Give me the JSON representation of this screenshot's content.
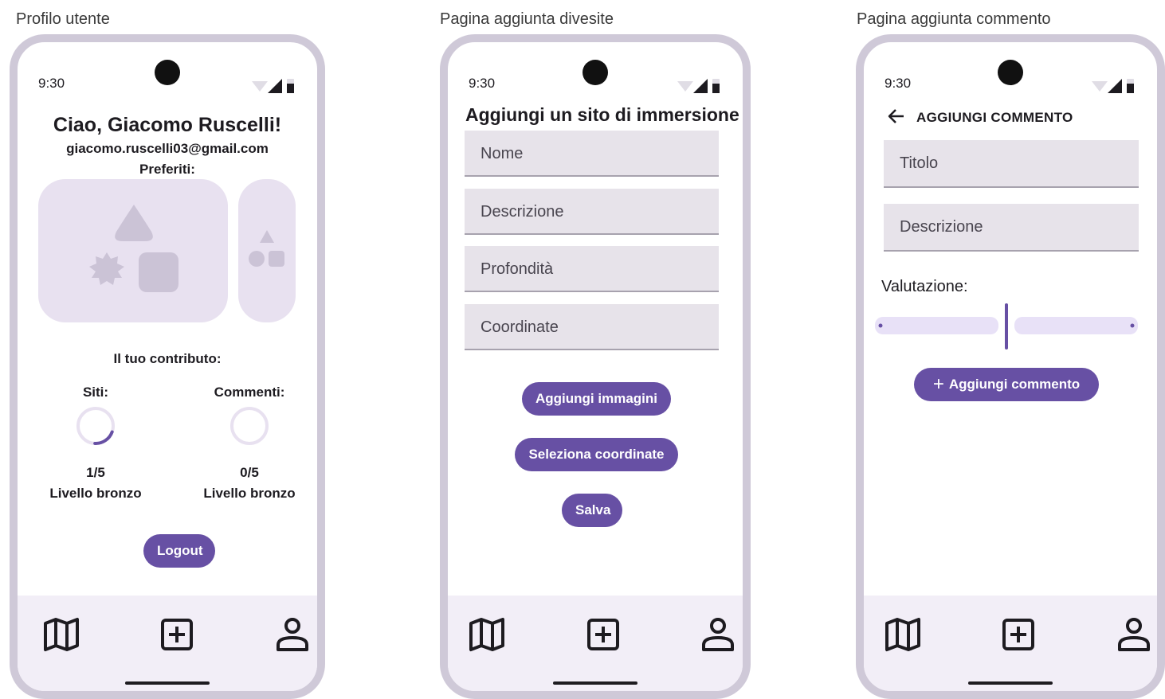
{
  "screens": [
    {
      "title": "Profilo utente"
    },
    {
      "title": "Pagina aggiunta divesite"
    },
    {
      "title": "Pagina aggiunta commento"
    }
  ],
  "status_bar": {
    "time": "9:30"
  },
  "profile": {
    "greeting": "Ciao, Giacomo Ruscelli!",
    "email": "giacomo.ruscelli03@gmail.com",
    "favorites_label": "Preferiti:",
    "contribution_label": "Il tuo contributo:",
    "sites": {
      "label": "Siti:",
      "count": "1/5",
      "level": "Livello bronzo",
      "progress": 0.2
    },
    "comments": {
      "label": "Commenti:",
      "count": "0/5",
      "level": "Livello bronzo",
      "progress": 0
    },
    "logout_label": "Logout"
  },
  "add_site": {
    "title": "Aggiungi un sito di immersione",
    "fields": {
      "name": "Nome",
      "description": "Descrizione",
      "depth": "Profondità",
      "coordinates": "Coordinate"
    },
    "add_images_label": "Aggiungi immagini",
    "select_coords_label": "Seleziona coordinate",
    "save_label": "Salva"
  },
  "add_comment": {
    "title": "AGGIUNGI COMMENTO",
    "fields": {
      "title": "Titolo",
      "description": "Descrizione"
    },
    "rating_label": "Valutazione:",
    "rating_value": 0.5,
    "add_comment_label": "Aggiungi commento"
  },
  "navbar": {
    "items": [
      {
        "icon": "map-icon"
      },
      {
        "icon": "add-box-icon"
      },
      {
        "icon": "person-icon"
      }
    ]
  },
  "colors": {
    "accent": "#6750a4",
    "field_bg": "#e7e3ea",
    "navbar_bg": "#f2eef7",
    "favorite_card": "#e8e1f0",
    "phone_frame": "#cfc9d8"
  }
}
